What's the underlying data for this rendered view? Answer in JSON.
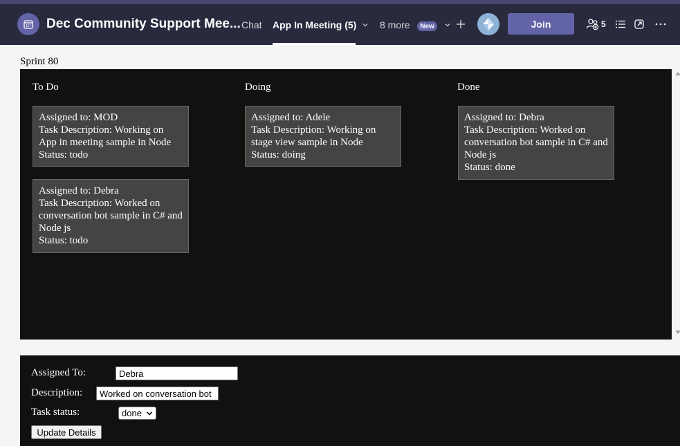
{
  "header": {
    "meeting_title": "Dec Community Support Mee...",
    "tabs": [
      {
        "label": "Chat",
        "active": false
      },
      {
        "label": "App In Meeting (5)",
        "active": true
      }
    ],
    "more_tabs_label": "8 more",
    "new_badge": "New",
    "join_label": "Join",
    "participants_count": "5",
    "accent_color": "#6264a7",
    "icons": [
      "calendar-icon",
      "chevron-down-icon",
      "add-tab-icon",
      "avatar-icon",
      "participants-icon",
      "list-icon",
      "popout-icon",
      "more-options-icon"
    ]
  },
  "board": {
    "title": "Sprint 80",
    "columns": [
      {
        "name": "To Do",
        "cards": [
          {
            "assigned": "Assigned to: MOD",
            "description": "Task Description: Working on App in meeting sample in Node",
            "status": "Status: todo"
          },
          {
            "assigned": "Assigned to: Debra",
            "description": "Task Description: Worked on conversation bot sample in C# and Node js",
            "status": "Status: todo"
          }
        ]
      },
      {
        "name": "Doing",
        "cards": [
          {
            "assigned": "Assigned to: Adele",
            "description": "Task Description: Working on stage view sample in Node",
            "status": "Status: doing"
          }
        ]
      },
      {
        "name": "Done",
        "cards": [
          {
            "assigned": "Assigned to: Debra",
            "description": "Task Description: Worked on conversation bot sample in C# and Node js",
            "status": "Status: done"
          }
        ]
      }
    ]
  },
  "form": {
    "assigned_label": "Assigned To:",
    "assigned_value": "Debra",
    "description_label": "Description:",
    "description_value": "Worked on conversation bot",
    "status_label": "Task status:",
    "status_value": "done",
    "update_button": "Update Details"
  }
}
